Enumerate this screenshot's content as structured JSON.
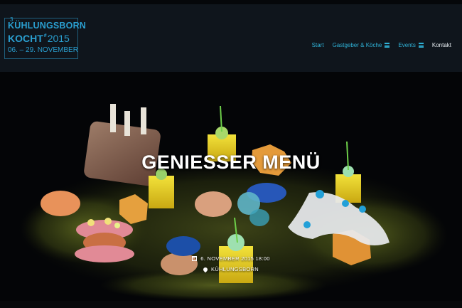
{
  "logo": {
    "line1": "KÜHLUNGSBORN",
    "line1_sup": "3",
    "line2_a": "KOCHT",
    "line2_hash": "#",
    "line2_year": "2015",
    "line3": "06. – 29. NOVEMBER"
  },
  "nav": {
    "items": [
      {
        "label": "Start",
        "icon": null
      },
      {
        "label": "Gastgeber & Köche",
        "icon": "menu-icon"
      },
      {
        "label": "Events",
        "icon": "menu-icon"
      },
      {
        "label": "Kontakt",
        "icon": null
      }
    ]
  },
  "hero": {
    "title": "GENIESSER MENÜ",
    "date": "6. NOVEMBER 2015 18:00",
    "location": "KÜHLUNGSBORN",
    "date_icon": "calendar-icon",
    "location_icon": "map-pin-icon"
  },
  "colors": {
    "accent": "#2fb1d6",
    "header_bg": "#0f151c",
    "hero_bg": "#040507"
  }
}
